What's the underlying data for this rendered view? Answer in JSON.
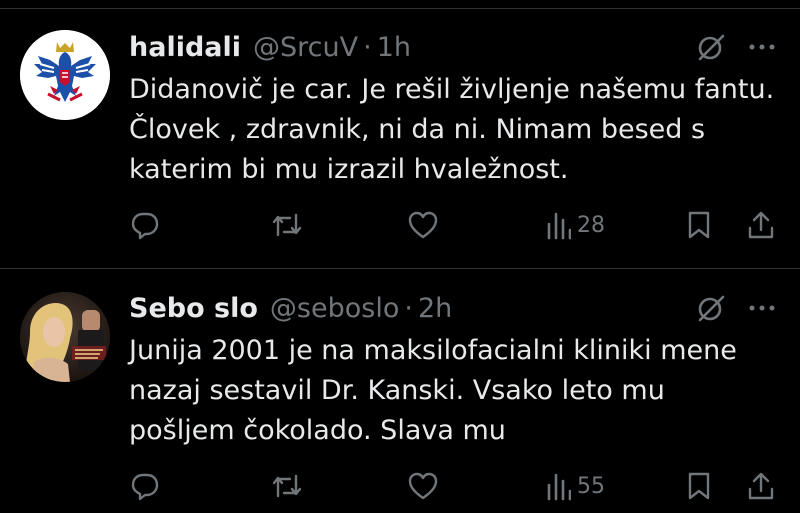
{
  "tweets": [
    {
      "name": "halidali",
      "handle": "@SrcuV",
      "separator": "·",
      "time": "1h",
      "text": "Didanovič je car. Je rešil življenje našemu fantu. Človek , zdravnik, ni da ni. Nimam besed s katerim bi mu izrazil hvaležnost.",
      "views": "28"
    },
    {
      "name": "Sebo slo",
      "handle": "@seboslo",
      "separator": "·",
      "time": "2h",
      "text": "Junija 2001 je na maksilofacialni kliniki mene nazaj sestavil Dr. Kanski. Vsako leto mu pošljem čokolado. Slava mu",
      "views": "55"
    }
  ],
  "colors": {
    "background": "#000000",
    "text": "#e7e9ea",
    "secondary": "#71767b",
    "divider": "#2f3336"
  },
  "icons": [
    "grok-icon",
    "more-icon",
    "reply-icon",
    "retweet-icon",
    "like-icon",
    "views-icon",
    "bookmark-icon",
    "share-icon"
  ]
}
